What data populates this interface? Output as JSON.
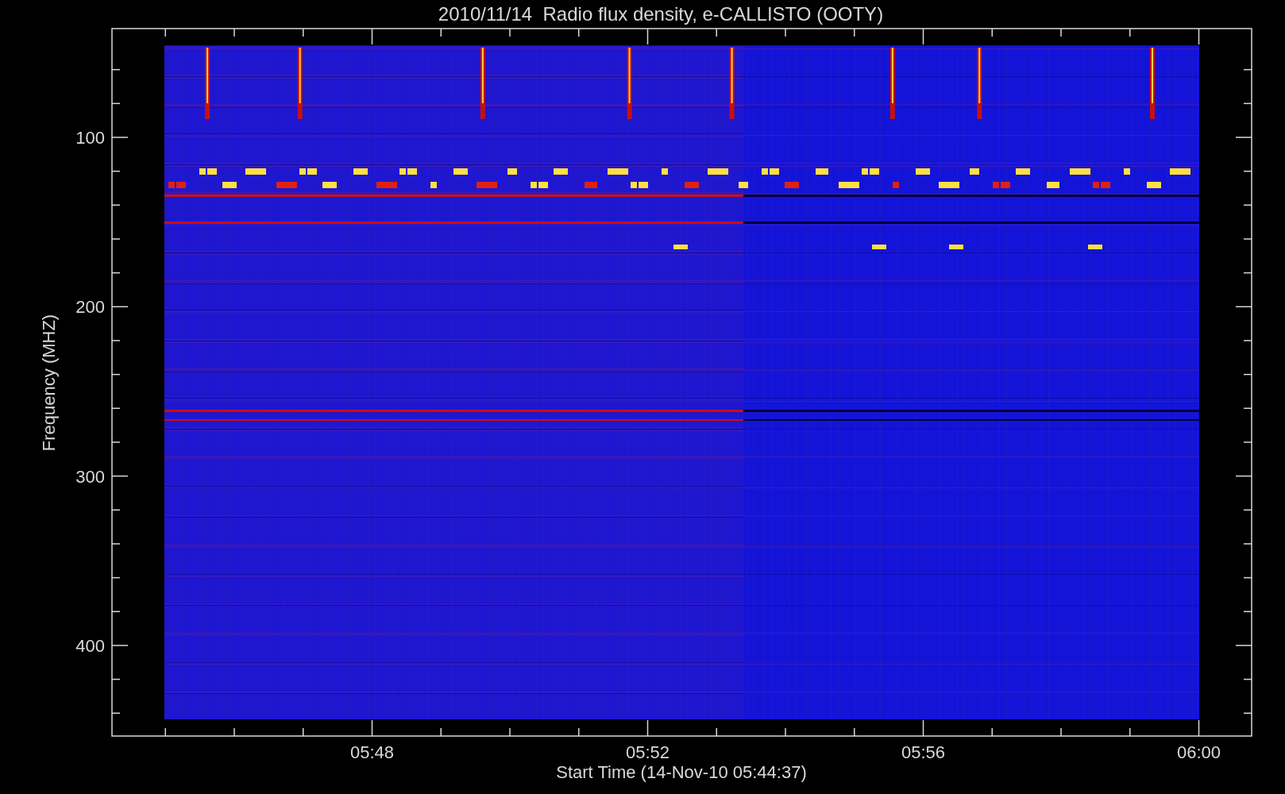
{
  "title": "2010/11/14  Radio flux density, e-CALLISTO (OOTY)",
  "y_axis": {
    "label": "Frequency (MHZ)",
    "ticks": [
      "100",
      "200",
      "300",
      "400"
    ]
  },
  "x_axis": {
    "label": "Start Time (14-Nov-10 05:44:37)",
    "ticks": [
      "05:48",
      "05:52",
      "05:56",
      "06:00"
    ]
  }
}
